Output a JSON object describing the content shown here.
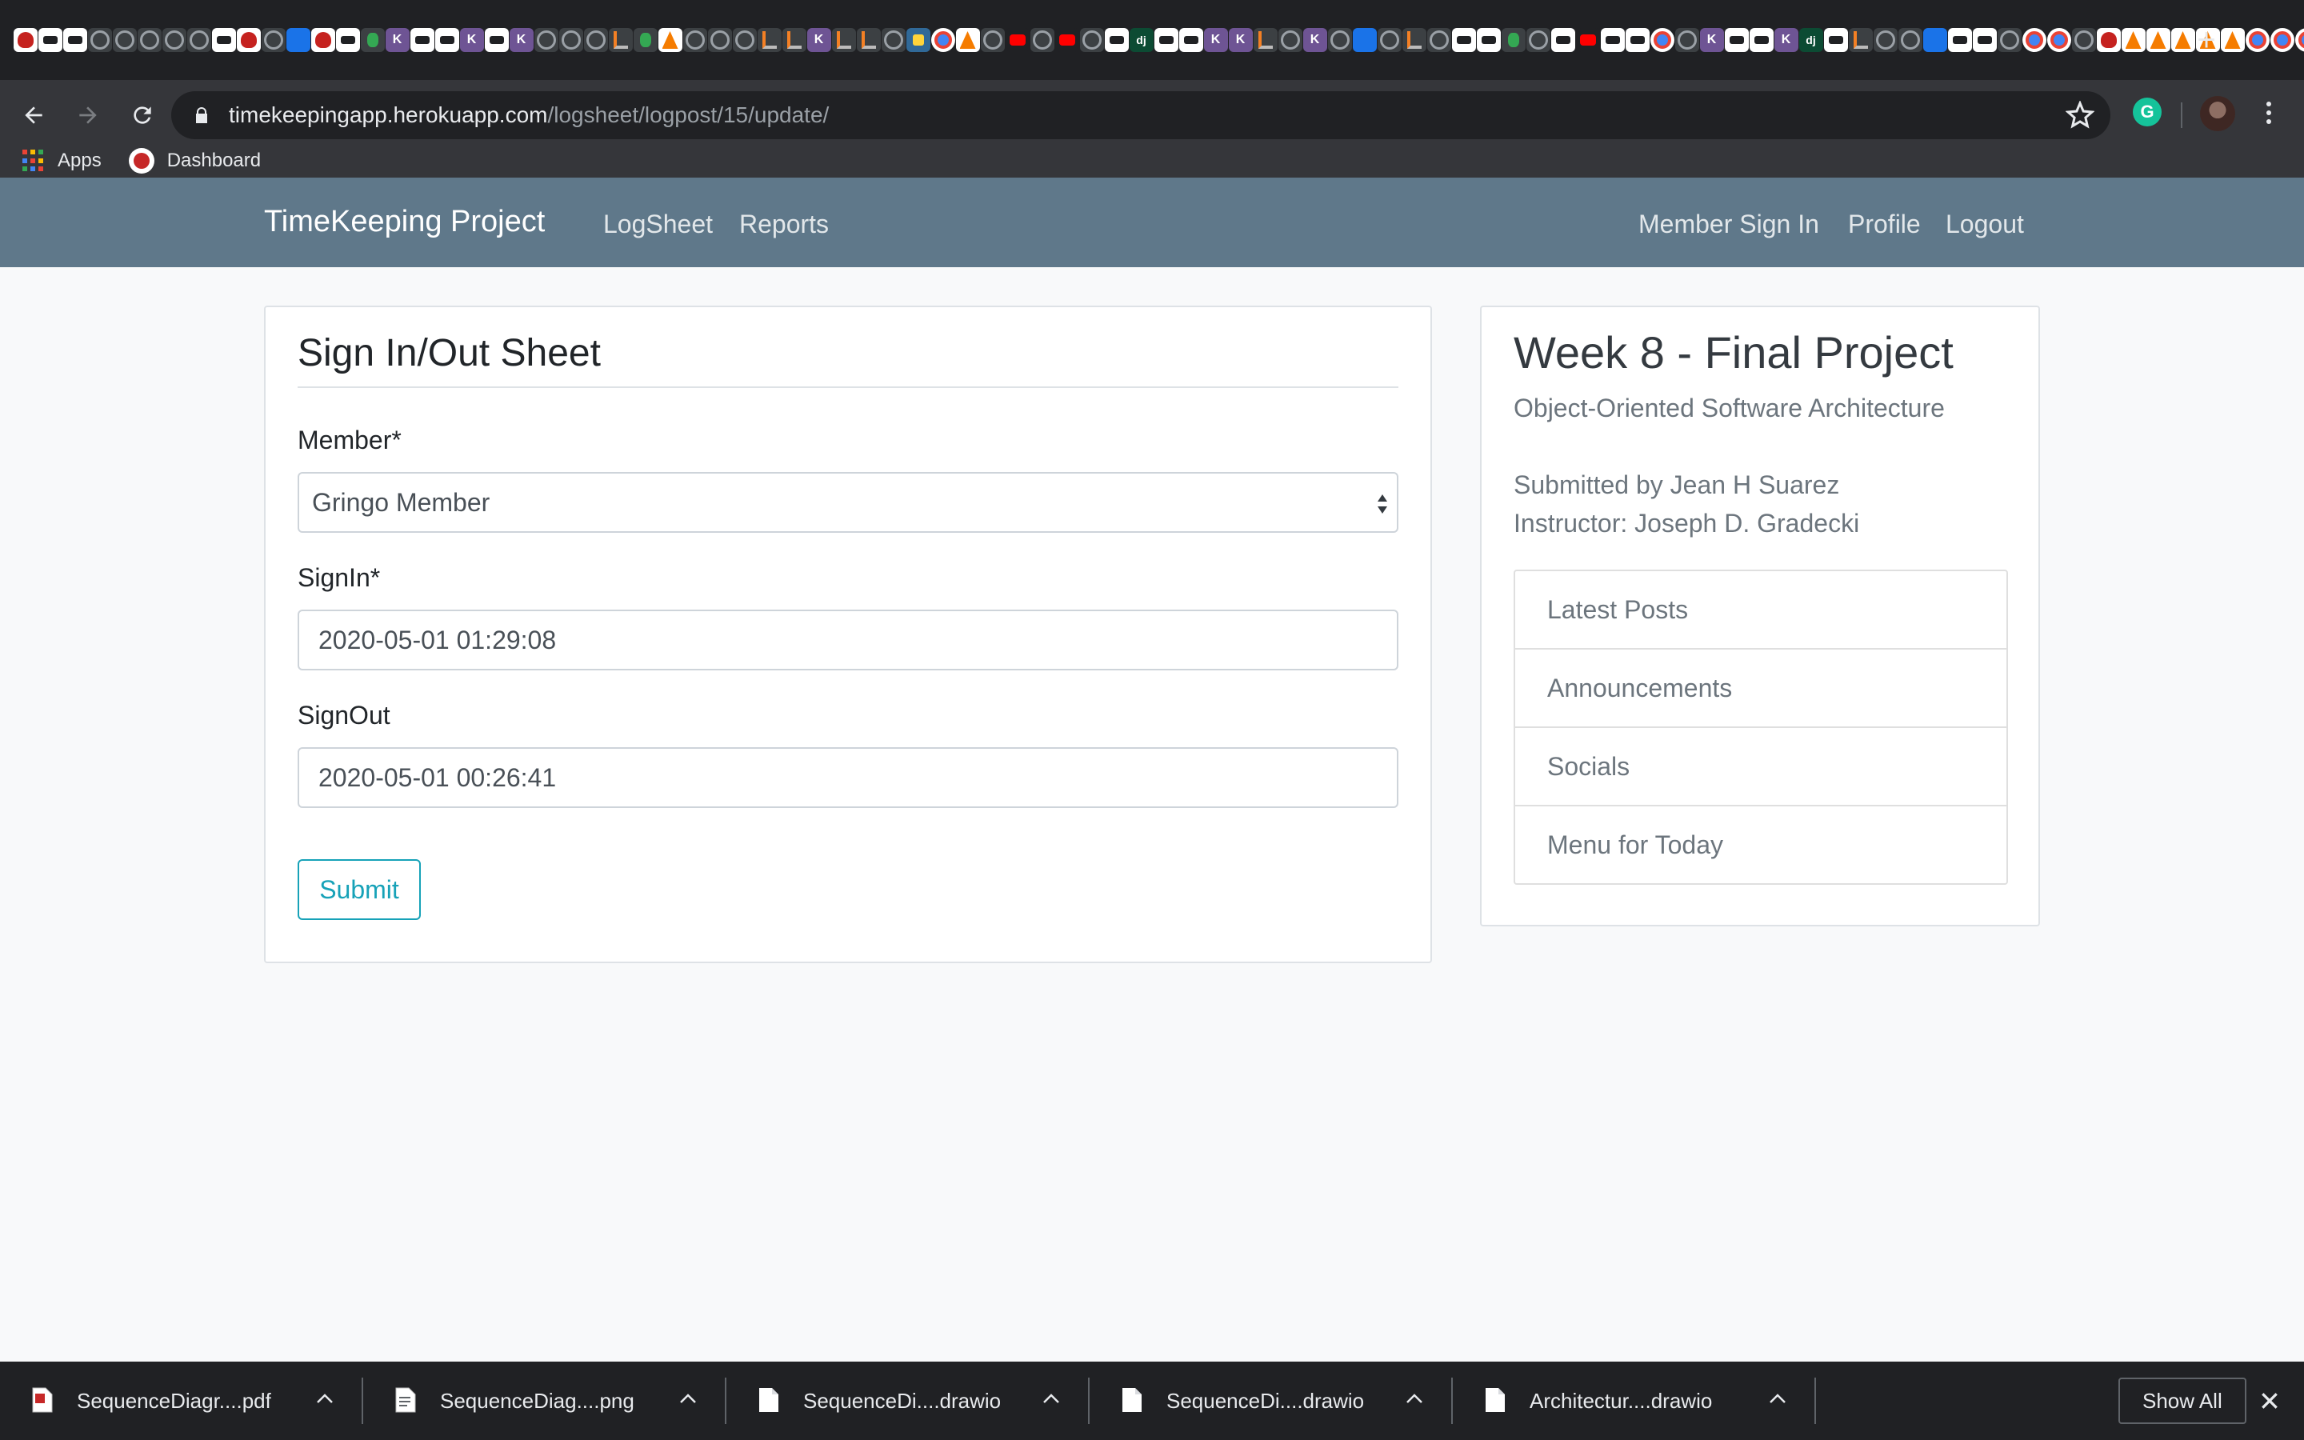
{
  "browser": {
    "tab_favicons": [
      "red",
      "white",
      "white",
      "gh",
      "gh",
      "gh",
      "gh",
      "gh",
      "white",
      "red",
      "gh",
      "blue",
      "red",
      "white",
      "green",
      "k",
      "white",
      "white",
      "k",
      "white",
      "k",
      "gh",
      "gh",
      "gh",
      "so",
      "green",
      "orange",
      "gh",
      "gh",
      "gh",
      "so",
      "so",
      "k",
      "so",
      "so",
      "gh",
      "py",
      "chrome",
      "orange",
      "gh",
      "yt",
      "gh",
      "yt",
      "gh",
      "white",
      "dj",
      "white",
      "white",
      "k",
      "k",
      "so",
      "gh",
      "k",
      "gh",
      "blue",
      "gh",
      "so",
      "gh",
      "white",
      "white",
      "green",
      "gh",
      "white",
      "yt",
      "white",
      "white",
      "chrome",
      "gh",
      "k",
      "white",
      "white",
      "k",
      "dj",
      "white",
      "so",
      "gh",
      "gh",
      "blue",
      "white",
      "white",
      "gh",
      "chrome",
      "chrome",
      "gh",
      "red",
      "orange",
      "orange",
      "orange",
      "orange",
      "orange",
      "chrome",
      "chrome",
      "chrome"
    ],
    "new_tab_label": "+",
    "url_host": "timekeepingapp.herokuapp.com",
    "url_path": "/logsheet/logpost/15/update/",
    "extension_letter": "G",
    "bookmarks": [
      {
        "label": "Apps",
        "icon": "apps-grid-icon"
      },
      {
        "label": "Dashboard",
        "icon": "dashboard-icon"
      }
    ]
  },
  "navbar": {
    "brand": "TimeKeeping Project",
    "left_links": [
      "LogSheet",
      "Reports"
    ],
    "right_links": [
      "Member Sign In",
      "Profile",
      "Logout"
    ],
    "background": "#5f788a"
  },
  "form": {
    "legend": "Sign In/Out Sheet",
    "member_label": "Member*",
    "member_value": "Gringo Member",
    "signin_label": "SignIn*",
    "signin_value": "2020-05-01 01:29:08",
    "signout_label": "SignOut",
    "signout_value": "2020-05-01 00:26:41",
    "submit_label": "Submit",
    "accent": "#17a2b8"
  },
  "sidebar": {
    "title": "Week 8 - Final Project",
    "subtitle": "Object-Oriented Software Architecture",
    "submitted_by": "Submitted by Jean H Suarez",
    "instructor": "Instructor: Joseph D. Gradecki",
    "items": [
      "Latest Posts",
      "Announcements",
      "Socials",
      "Menu for Today"
    ]
  },
  "downloads": {
    "items": [
      {
        "name": "SequenceDiagr....pdf",
        "icon": "pdf-file-icon"
      },
      {
        "name": "SequenceDiag....png",
        "icon": "image-file-icon"
      },
      {
        "name": "SequenceDi....drawio",
        "icon": "file-icon"
      },
      {
        "name": "SequenceDi....drawio",
        "icon": "file-icon"
      },
      {
        "name": "Architectur....drawio",
        "icon": "file-icon"
      }
    ],
    "show_all_label": "Show All"
  }
}
